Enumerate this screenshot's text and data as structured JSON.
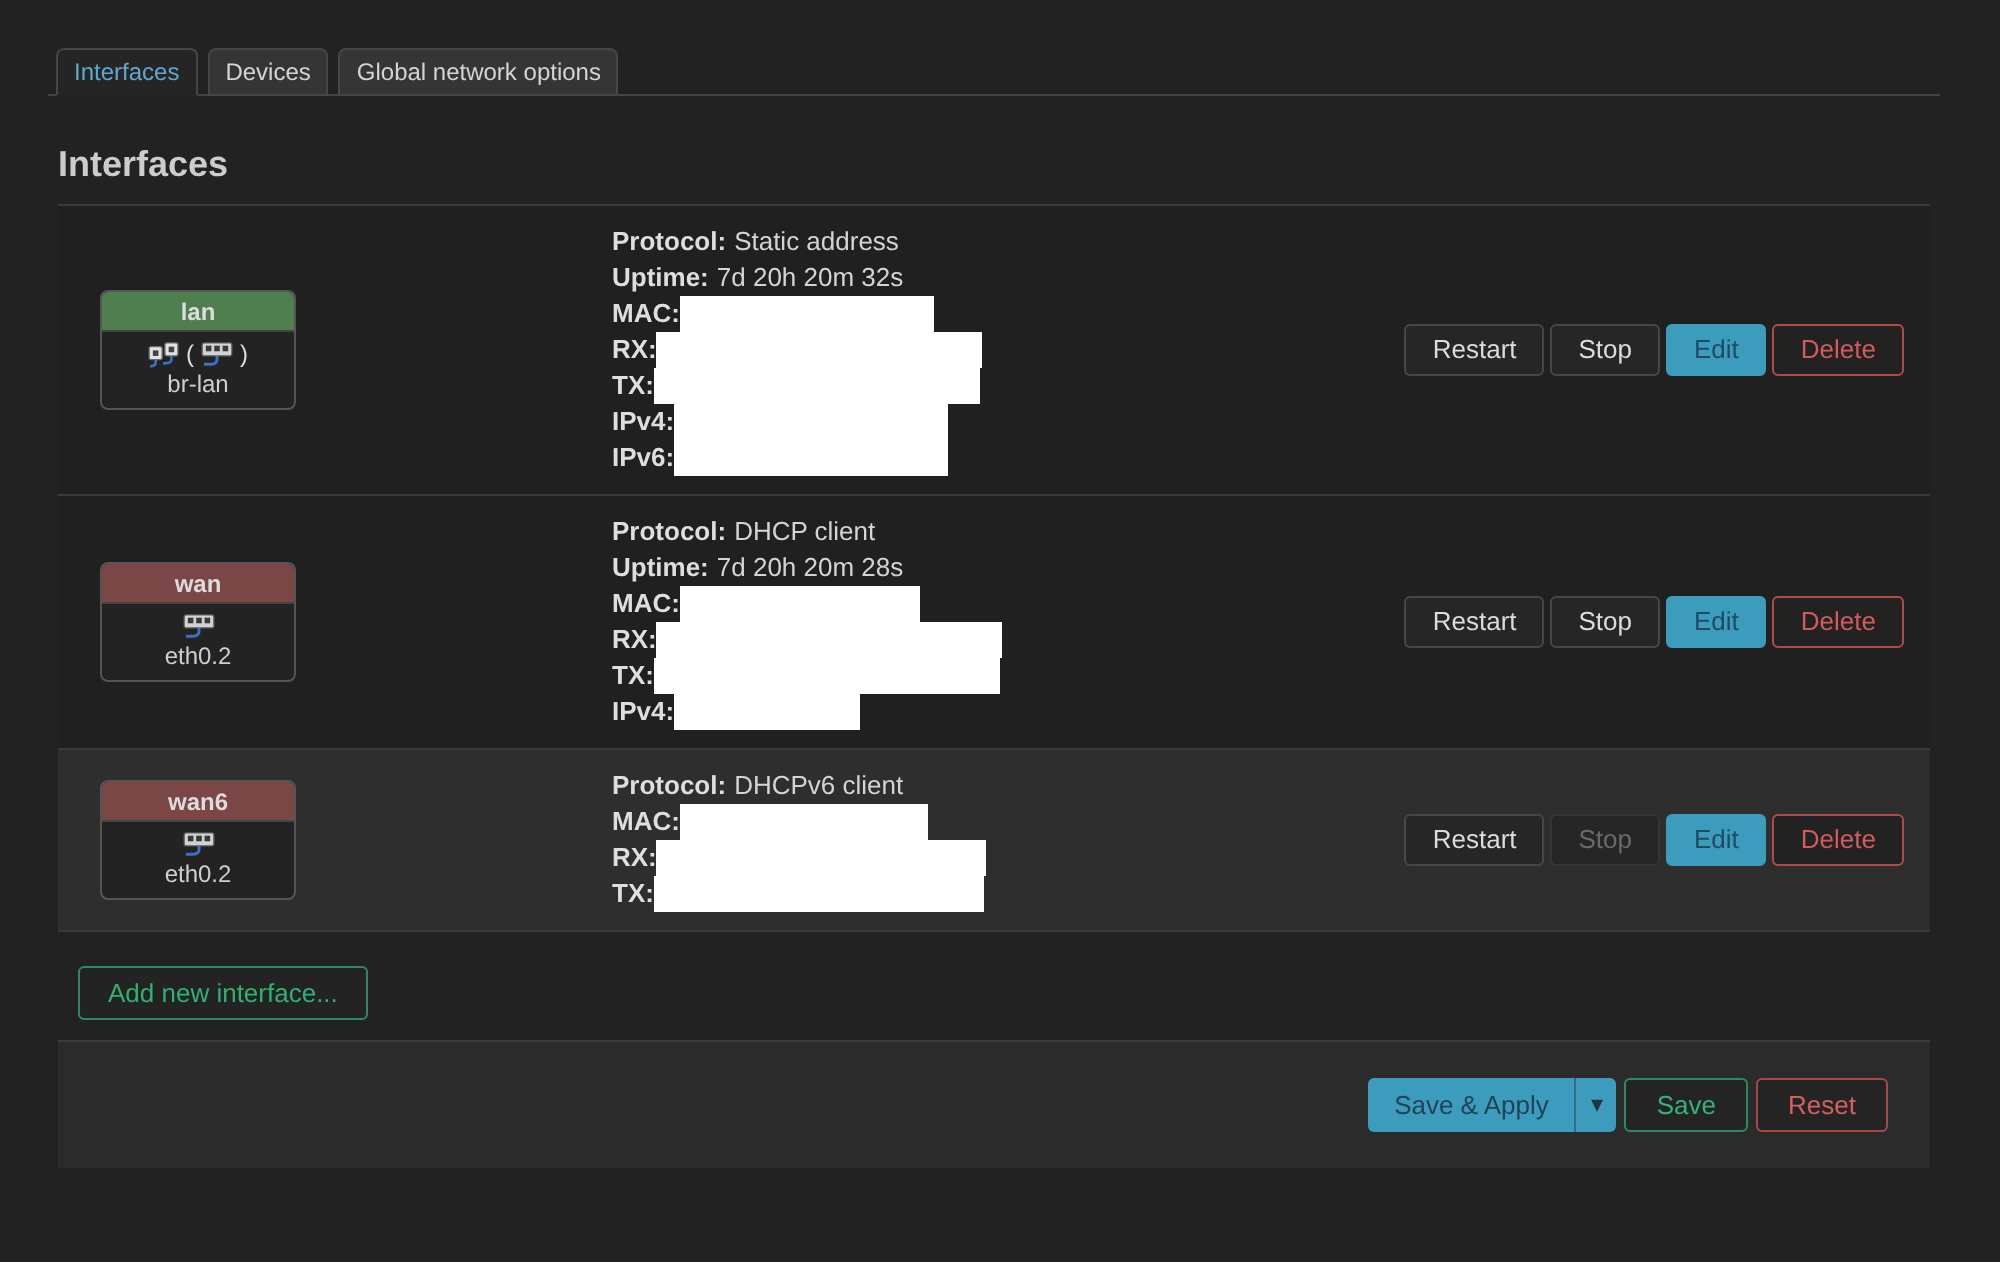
{
  "tabs": [
    {
      "label": "Interfaces",
      "selected": true
    },
    {
      "label": "Devices",
      "selected": false
    },
    {
      "label": "Global network options",
      "selected": false
    }
  ],
  "heading": "Interfaces",
  "interfaces": [
    {
      "name": "lan",
      "color": "#4f7f4f",
      "highlighted": false,
      "device": {
        "kind": "bridge",
        "name": "br-lan",
        "brackets": [
          "(",
          ")"
        ]
      },
      "details": [
        {
          "label": "Protocol:",
          "value": "Static address"
        },
        {
          "label": "Uptime:",
          "value": "7d 20h 20m 32s"
        },
        {
          "label": "MAC:",
          "redacted": true
        },
        {
          "label": "RX:",
          "redacted": true
        },
        {
          "label": "TX:",
          "redacted": true
        },
        {
          "label": "IPv4:",
          "redacted": true
        },
        {
          "label": "IPv6:",
          "redacted": true
        }
      ],
      "actions": [
        {
          "label": "Restart",
          "kind": "plain",
          "disabled": false
        },
        {
          "label": "Stop",
          "kind": "plain",
          "disabled": false
        },
        {
          "label": "Edit",
          "kind": "primary",
          "disabled": false
        },
        {
          "label": "Delete",
          "kind": "danger",
          "disabled": false
        }
      ]
    },
    {
      "name": "wan",
      "color": "#7a4646",
      "highlighted": false,
      "device": {
        "kind": "port",
        "name": "eth0.2"
      },
      "details": [
        {
          "label": "Protocol:",
          "value": "DHCP client"
        },
        {
          "label": "Uptime:",
          "value": "7d 20h 20m 28s"
        },
        {
          "label": "MAC:",
          "redacted": true
        },
        {
          "label": "RX:",
          "redacted": true
        },
        {
          "label": "TX:",
          "redacted": true
        },
        {
          "label": "IPv4:",
          "redacted": true
        }
      ],
      "actions": [
        {
          "label": "Restart",
          "kind": "plain",
          "disabled": false
        },
        {
          "label": "Stop",
          "kind": "plain",
          "disabled": false
        },
        {
          "label": "Edit",
          "kind": "primary",
          "disabled": false
        },
        {
          "label": "Delete",
          "kind": "danger",
          "disabled": false
        }
      ]
    },
    {
      "name": "wan6",
      "color": "#7a4646",
      "highlighted": true,
      "device": {
        "kind": "port",
        "name": "eth0.2"
      },
      "details": [
        {
          "label": "Protocol:",
          "value": "DHCPv6 client"
        },
        {
          "label": "MAC:",
          "redacted": true
        },
        {
          "label": "RX:",
          "redacted": true
        },
        {
          "label": "TX:",
          "redacted": true
        }
      ],
      "actions": [
        {
          "label": "Restart",
          "kind": "plain",
          "disabled": false
        },
        {
          "label": "Stop",
          "kind": "plain",
          "disabled": true
        },
        {
          "label": "Edit",
          "kind": "primary",
          "disabled": false
        },
        {
          "label": "Delete",
          "kind": "danger",
          "disabled": false
        }
      ]
    }
  ],
  "add_button": "Add new interface...",
  "footer": {
    "buttons": [
      {
        "label": "Save & Apply",
        "kind": "split",
        "caret": "▾"
      },
      {
        "label": "Save",
        "kind": "success"
      },
      {
        "label": "Reset",
        "kind": "danger"
      }
    ]
  }
}
